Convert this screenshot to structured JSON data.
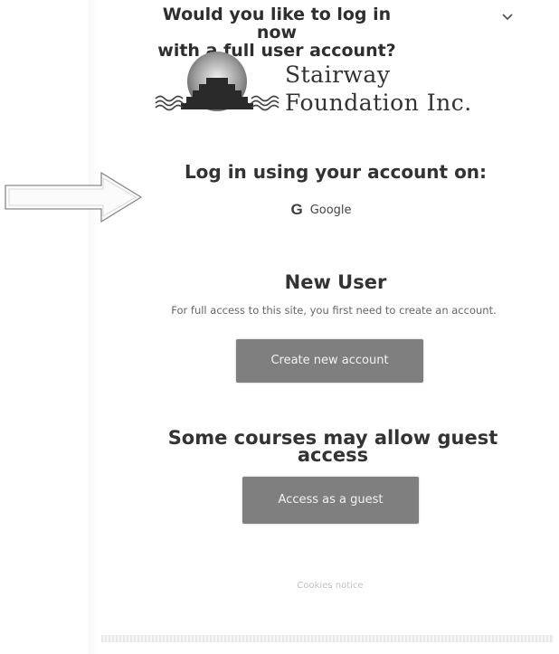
{
  "prompt": {
    "line1": "Would you like to log in now",
    "line2": "with a full user account?",
    "chevron_icon": "chevron-down-icon"
  },
  "logo": {
    "line1": "Stairway",
    "line2": "Foundation Inc."
  },
  "login": {
    "heading": "Log in using your account on:",
    "google_label": "Google",
    "google_icon": "G"
  },
  "new_user": {
    "heading": "New User",
    "text": "For full access to this site, you first need to create an account.",
    "button_label": "Create new account"
  },
  "guest": {
    "heading_line1": "Some courses may allow guest",
    "heading_line2": "access",
    "button_label": "Access as a guest"
  },
  "footer": {
    "cookies_label": "Cookies notice"
  },
  "colors": {
    "button_bg": "#7f7f7f",
    "text": "#333333"
  }
}
